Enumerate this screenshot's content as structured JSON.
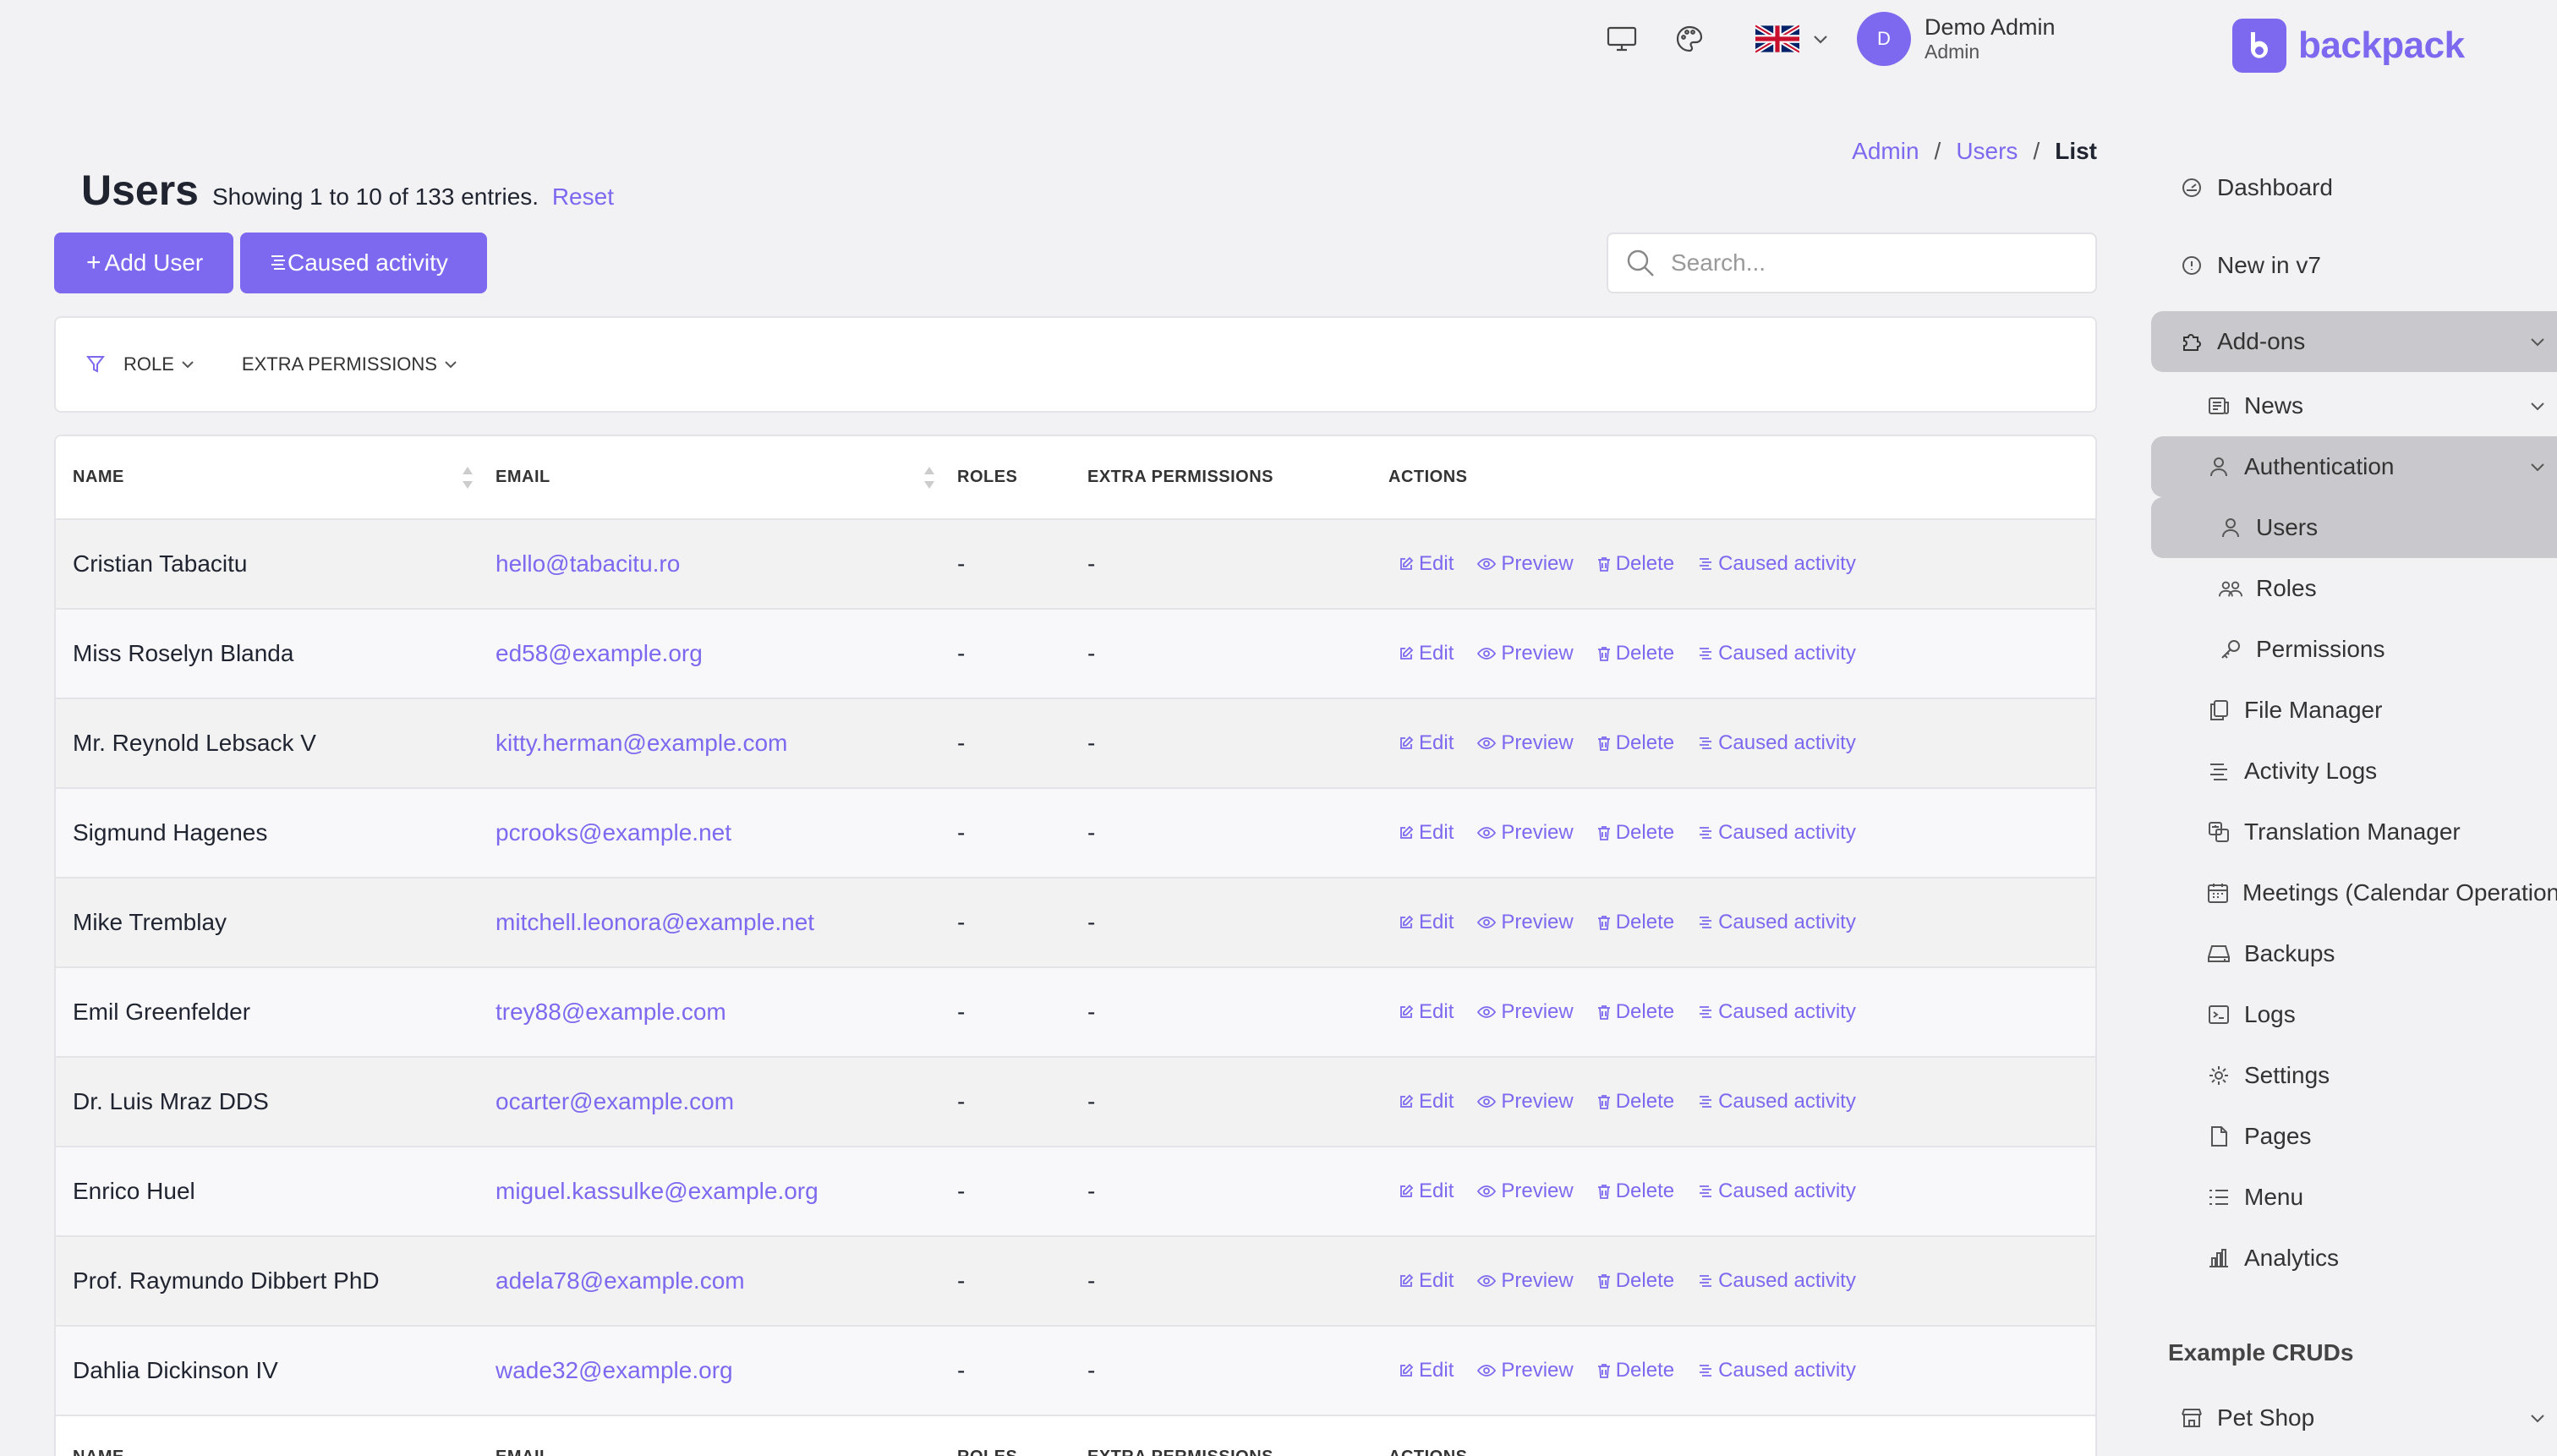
{
  "brand": {
    "name": "backpack",
    "logo_letter": "b",
    "accent": "#7c69ef"
  },
  "topbar": {
    "icons": [
      "monitor-icon",
      "palette-icon"
    ],
    "language": "uk-flag",
    "user": {
      "avatar_initial": "D",
      "name": "Demo Admin",
      "role": "Admin"
    }
  },
  "breadcrumb": {
    "admin": "Admin",
    "users": "Users",
    "current": "List",
    "sep1": "/",
    "sep2": "/"
  },
  "page": {
    "title": "Users",
    "subtitle": "Showing 1 to 10 of 133 entries.",
    "reset": "Reset",
    "add_button": "Add User",
    "add_plus": "+",
    "activity_button": "Caused activity",
    "search_placeholder": "Search..."
  },
  "filters": {
    "role": "ROLE",
    "extra_permissions": "EXTRA PERMISSIONS"
  },
  "table": {
    "columns": [
      "NAME",
      "EMAIL",
      "ROLES",
      "EXTRA PERMISSIONS",
      "ACTIONS"
    ],
    "action_labels": {
      "edit": "Edit",
      "preview": "Preview",
      "delete": "Delete",
      "activity": "Caused activity"
    },
    "rows": [
      {
        "name": "Cristian Tabacitu",
        "email": "hello@tabacitu.ro",
        "roles": "-",
        "extra": "-"
      },
      {
        "name": "Miss Roselyn Blanda",
        "email": "ed58@example.org",
        "roles": "-",
        "extra": "-"
      },
      {
        "name": "Mr. Reynold Lebsack V",
        "email": "kitty.herman@example.com",
        "roles": "-",
        "extra": "-"
      },
      {
        "name": "Sigmund Hagenes",
        "email": "pcrooks@example.net",
        "roles": "-",
        "extra": "-"
      },
      {
        "name": "Mike Tremblay",
        "email": "mitchell.leonora@example.net",
        "roles": "-",
        "extra": "-"
      },
      {
        "name": "Emil Greenfelder",
        "email": "trey88@example.com",
        "roles": "-",
        "extra": "-"
      },
      {
        "name": "Dr. Luis Mraz DDS",
        "email": "ocarter@example.com",
        "roles": "-",
        "extra": "-"
      },
      {
        "name": "Enrico Huel",
        "email": "miguel.kassulke@example.org",
        "roles": "-",
        "extra": "-"
      },
      {
        "name": "Prof. Raymundo Dibbert PhD",
        "email": "adela78@example.com",
        "roles": "-",
        "extra": "-"
      },
      {
        "name": "Dahlia Dickinson IV",
        "email": "wade32@example.org",
        "roles": "-",
        "extra": "-"
      }
    ]
  },
  "sidebar": {
    "items": [
      {
        "label": "Dashboard",
        "icon": "dashboard-icon"
      },
      {
        "label": "New in v7",
        "icon": "info-icon"
      },
      {
        "label": "Add-ons",
        "icon": "puzzle-icon"
      },
      {
        "label": "News",
        "icon": "news-icon"
      },
      {
        "label": "Authentication",
        "icon": "user-icon"
      },
      {
        "label": "Users",
        "icon": "user-icon"
      },
      {
        "label": "Roles",
        "icon": "group-icon"
      },
      {
        "label": "Permissions",
        "icon": "key-icon"
      },
      {
        "label": "File Manager",
        "icon": "files-icon"
      },
      {
        "label": "Activity Logs",
        "icon": "activity-icon"
      },
      {
        "label": "Translation Manager",
        "icon": "language-icon"
      },
      {
        "label": "Meetings (Calendar Operation)",
        "icon": "calendar-icon"
      },
      {
        "label": "Backups",
        "icon": "drive-icon"
      },
      {
        "label": "Logs",
        "icon": "terminal-icon"
      },
      {
        "label": "Settings",
        "icon": "gear-icon"
      },
      {
        "label": "Pages",
        "icon": "page-icon"
      },
      {
        "label": "Menu",
        "icon": "list-icon"
      },
      {
        "label": "Analytics",
        "icon": "chart-icon"
      }
    ],
    "heading": "Example CRUDs",
    "pet_shop": {
      "label": "Pet Shop",
      "icon": "shop-icon"
    }
  }
}
